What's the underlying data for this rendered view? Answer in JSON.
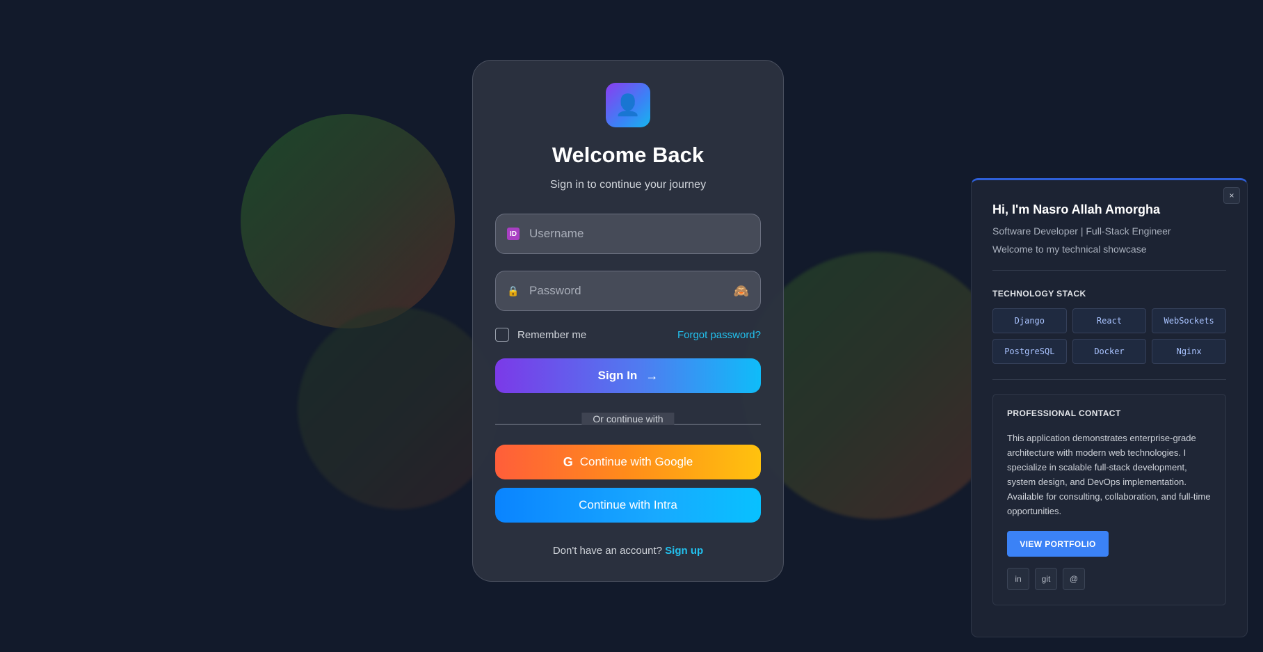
{
  "login": {
    "logo_icon": "user-icon",
    "title": "Welcome Back",
    "subtitle": "Sign in to continue your journey",
    "username": {
      "placeholder": "Username",
      "value": "",
      "icon": "id-icon"
    },
    "password": {
      "placeholder": "Password",
      "value": "",
      "icon": "lock-icon",
      "toggle_icon": "see-no-evil-monkey-icon"
    },
    "remember_label": "Remember me",
    "remember_checked": false,
    "forgot_label": "Forgot password?",
    "signin_label": "Sign In",
    "signin_arrow": "→",
    "divider_text": "Or continue with",
    "google_label": "Continue with Google",
    "google_glyph": "G",
    "intra_label": "Continue with Intra",
    "signup_prompt": "Don't have an account?",
    "signup_label": "Sign up"
  },
  "panel": {
    "close_label": "×",
    "name": "Hi, I'm Nasro Allah Amorgha",
    "role": "Software Developer | Full-Stack Engineer",
    "welcome": "Welcome to my technical showcase",
    "tech_title": "TECHNOLOGY STACK",
    "tech": [
      "Django",
      "React",
      "WebSockets",
      "PostgreSQL",
      "Docker",
      "Nginx"
    ],
    "contact_title": "PROFESSIONAL CONTACT",
    "contact_text": "This application demonstrates enterprise-grade architecture with modern web technologies. I specialize in scalable full-stack development, system design, and DevOps implementation. Available for consulting, collaboration, and full-time opportunities.",
    "portfolio_label": "VIEW PORTFOLIO",
    "socials": [
      "in",
      "git",
      "@"
    ]
  },
  "colors": {
    "background": "#121a2b",
    "accent_cyan": "#22c1ee",
    "accent_blue": "#3b82f6",
    "signin_gradient": [
      "#7b3ae8",
      "#0fbcf9"
    ],
    "google_gradient": [
      "#ff5e3a",
      "#ffc20e"
    ],
    "intra_gradient": [
      "#0a84ff",
      "#08c1ff"
    ]
  }
}
